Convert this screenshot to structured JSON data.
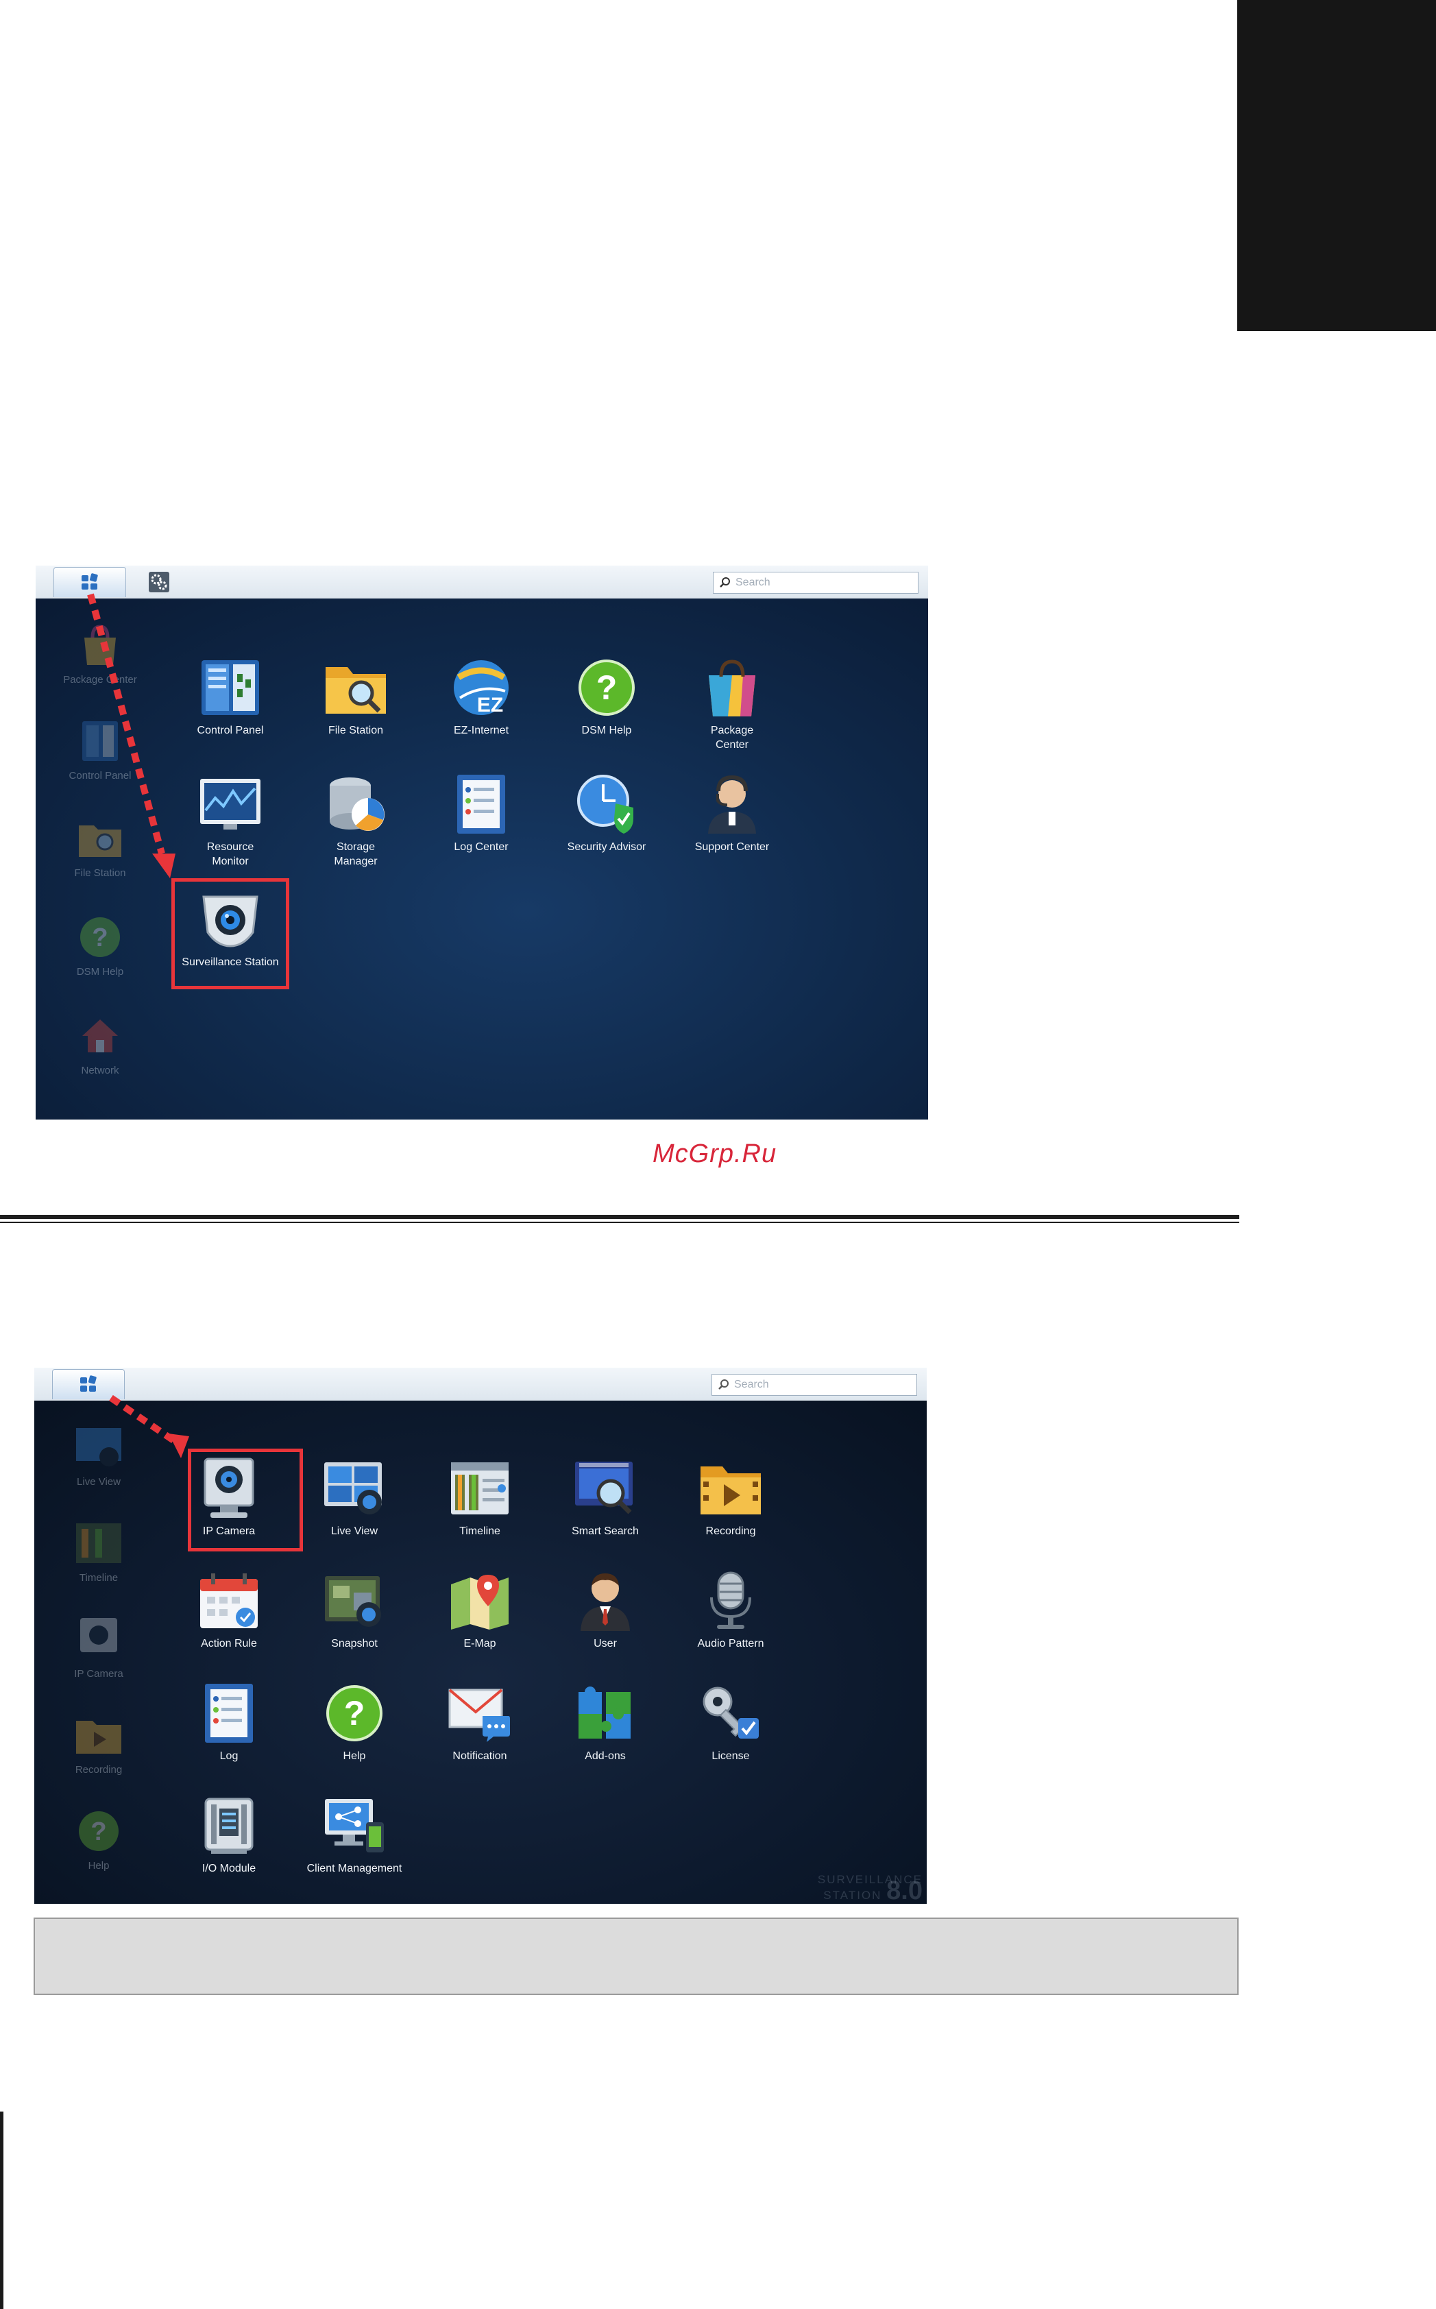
{
  "watermark": "McGrp.Ru",
  "screen1": {
    "search_placeholder": "Search",
    "dock": [
      "Package Center",
      "Control Panel",
      "File Station",
      "DSM Help",
      "Network"
    ],
    "apps": [
      {
        "label": "Control Panel",
        "icon": "control-panel-icon"
      },
      {
        "label": "File Station",
        "icon": "folder-search-icon"
      },
      {
        "label": "EZ-Internet",
        "icon": "ez-internet-globe-icon"
      },
      {
        "label": "DSM Help",
        "icon": "help-icon"
      },
      {
        "label": "Package\nCenter",
        "icon": "shopping-bag-icon"
      },
      {
        "label": "Resource\nMonitor",
        "icon": "monitor-graph-icon"
      },
      {
        "label": "Storage\nManager",
        "icon": "storage-disk-icon"
      },
      {
        "label": "Log Center",
        "icon": "log-document-icon"
      },
      {
        "label": "Security Advisor",
        "icon": "shield-clock-icon"
      },
      {
        "label": "Support Center",
        "icon": "support-headset-icon"
      },
      {
        "label": "Surveillance Station",
        "icon": "surveillance-camera-icon"
      }
    ]
  },
  "screen2": {
    "search_placeholder": "Search",
    "dock": [
      "Live View",
      "Timeline",
      "IP Camera",
      "Recording",
      "Help"
    ],
    "apps": [
      {
        "label": "IP Camera",
        "icon": "ip-camera-icon"
      },
      {
        "label": "Live View",
        "icon": "live-view-icon"
      },
      {
        "label": "Timeline",
        "icon": "timeline-icon"
      },
      {
        "label": "Smart Search",
        "icon": "smart-search-icon"
      },
      {
        "label": "Recording",
        "icon": "recording-folder-icon"
      },
      {
        "label": "Action Rule",
        "icon": "calendar-icon"
      },
      {
        "label": "Snapshot",
        "icon": "snapshot-icon"
      },
      {
        "label": "E-Map",
        "icon": "map-pin-icon"
      },
      {
        "label": "User",
        "icon": "user-icon"
      },
      {
        "label": "Audio Pattern",
        "icon": "microphone-icon"
      },
      {
        "label": "Log",
        "icon": "log-document-icon"
      },
      {
        "label": "Help",
        "icon": "help-icon"
      },
      {
        "label": "Notification",
        "icon": "notification-mail-icon"
      },
      {
        "label": "Add-ons",
        "icon": "puzzle-icon"
      },
      {
        "label": "License",
        "icon": "license-key-icon"
      },
      {
        "label": "I/O Module",
        "icon": "io-module-icon"
      },
      {
        "label": "Client Management",
        "icon": "client-management-icon"
      }
    ],
    "logo_line1": "SURVEILLANCE",
    "logo_line2": "STATION",
    "logo_version": "8.0"
  }
}
